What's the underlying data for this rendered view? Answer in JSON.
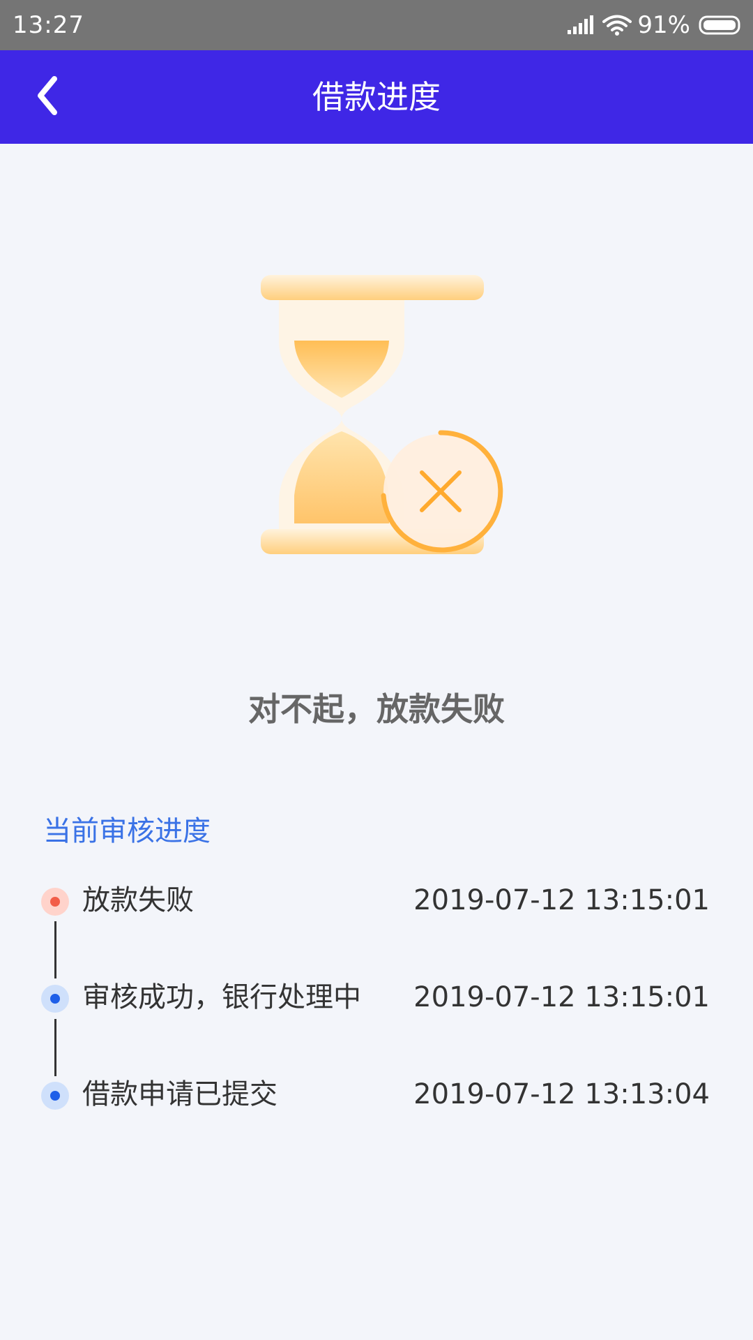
{
  "status_bar": {
    "time": "13:27",
    "battery": "91%",
    "icons": [
      "signal-icon",
      "wifi-icon",
      "battery-icon"
    ]
  },
  "header": {
    "title": "借款进度",
    "back_icon": "chevron-left-icon",
    "background_color": "#3f27e6"
  },
  "illustration": {
    "icon": "hourglass-failed-icon"
  },
  "result": {
    "title": "对不起，放款失败"
  },
  "progress": {
    "section_title": "当前审核进度",
    "steps": [
      {
        "label": "放款失败",
        "time": "2019-07-12 13:15:01",
        "status": "failed"
      },
      {
        "label": "审核成功，银行处理中",
        "time": "2019-07-12 13:15:01",
        "status": "done"
      },
      {
        "label": "借款申请已提交",
        "time": "2019-07-12 13:13:04",
        "status": "done"
      }
    ]
  },
  "colors": {
    "accent": "#3a72e6",
    "failed": "#f25d48",
    "done": "#1f5fe8"
  }
}
